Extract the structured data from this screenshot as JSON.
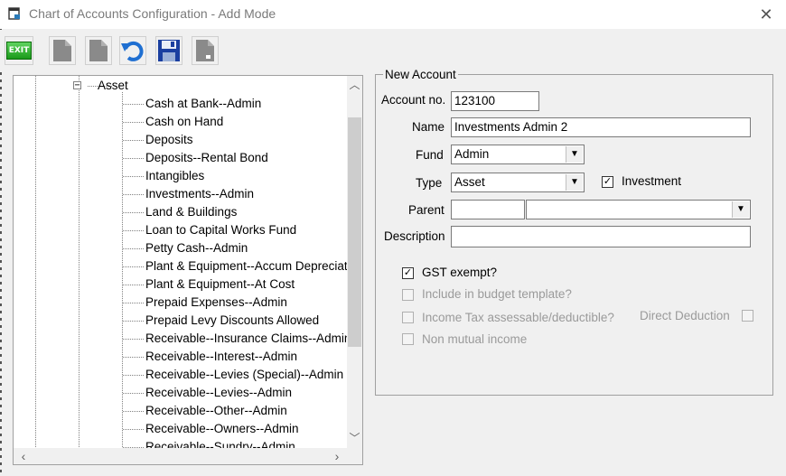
{
  "window": {
    "title": "Chart of Accounts Configuration - Add Mode"
  },
  "toolbar": {
    "exit_label": "EXIT"
  },
  "tree": {
    "root": "Asset",
    "items": [
      "Cash at Bank--Admin",
      "Cash on Hand",
      "Deposits",
      "Deposits--Rental Bond",
      "Intangibles",
      "Investments--Admin",
      "Land & Buildings",
      "Loan to Capital Works Fund",
      "Petty Cash--Admin",
      "Plant & Equipment--Accum Depreciati",
      "Plant & Equipment--At Cost",
      "Prepaid Expenses--Admin",
      "Prepaid Levy Discounts Allowed",
      "Receivable--Insurance Claims--Admin",
      "Receivable--Interest--Admin",
      "Receivable--Levies (Special)--Admin",
      "Receivable--Levies--Admin",
      "Receivable--Other--Admin",
      "Receivable--Owners--Admin",
      "Receivable--Sundry--Admin"
    ]
  },
  "form": {
    "group_title": "New Account",
    "account_no_label": "Account no.",
    "account_no": "123100",
    "name_label": "Name",
    "name": "Investments Admin 2",
    "fund_label": "Fund",
    "fund": "Admin",
    "type_label": "Type",
    "type": "Asset",
    "investment_label": "Investment",
    "investment_checked": "✓",
    "parent_label": "Parent",
    "parent_code": "",
    "parent_name": "",
    "description_label": "Description",
    "description": "",
    "gst_label": "GST exempt?",
    "gst_checked": "✓",
    "budget_label": "Include in budget template?",
    "income_tax_label": "Income Tax assessable/deductible?",
    "direct_deduction_label": "Direct Deduction",
    "non_mutual_label": "Non mutual income"
  }
}
